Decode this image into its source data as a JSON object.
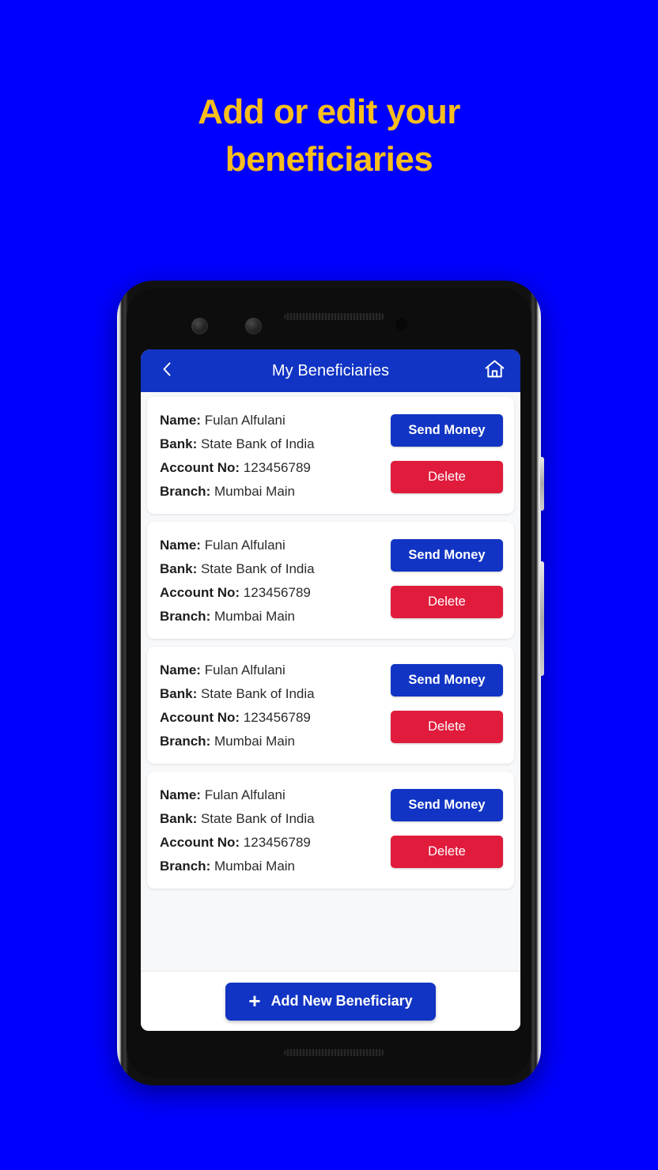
{
  "promo": {
    "headline_line1": "Add or edit your",
    "headline_line2": "beneficiaries",
    "headline_color": "#F7BE1E",
    "background_color": "#0000FF"
  },
  "app": {
    "appbar": {
      "title": "My Beneficiaries",
      "back_icon": "chevron-left-icon",
      "home_icon": "home-icon",
      "background_color": "#1134C4"
    },
    "labels": {
      "name": "Name:",
      "bank": "Bank:",
      "account_no": "Account No:",
      "branch": "Branch:"
    },
    "actions": {
      "send_money": "Send Money",
      "delete": "Delete",
      "send_money_color": "#1134C4",
      "delete_color": "#E01B3C"
    },
    "beneficiaries": [
      {
        "name": "Fulan Alfulani",
        "bank": "State Bank of India",
        "account_no": "123456789",
        "branch": "Mumbai Main"
      },
      {
        "name": "Fulan Alfulani",
        "bank": "State Bank of India",
        "account_no": "123456789",
        "branch": "Mumbai Main"
      },
      {
        "name": "Fulan Alfulani",
        "bank": "State Bank of India",
        "account_no": "123456789",
        "branch": "Mumbai Main"
      },
      {
        "name": "Fulan Alfulani",
        "bank": "State Bank of India",
        "account_no": "123456789",
        "branch": "Mumbai Main"
      }
    ],
    "bottom_bar": {
      "add_label": "Add New Beneficiary",
      "add_icon": "plus-icon",
      "plus_glyph": "+"
    }
  }
}
